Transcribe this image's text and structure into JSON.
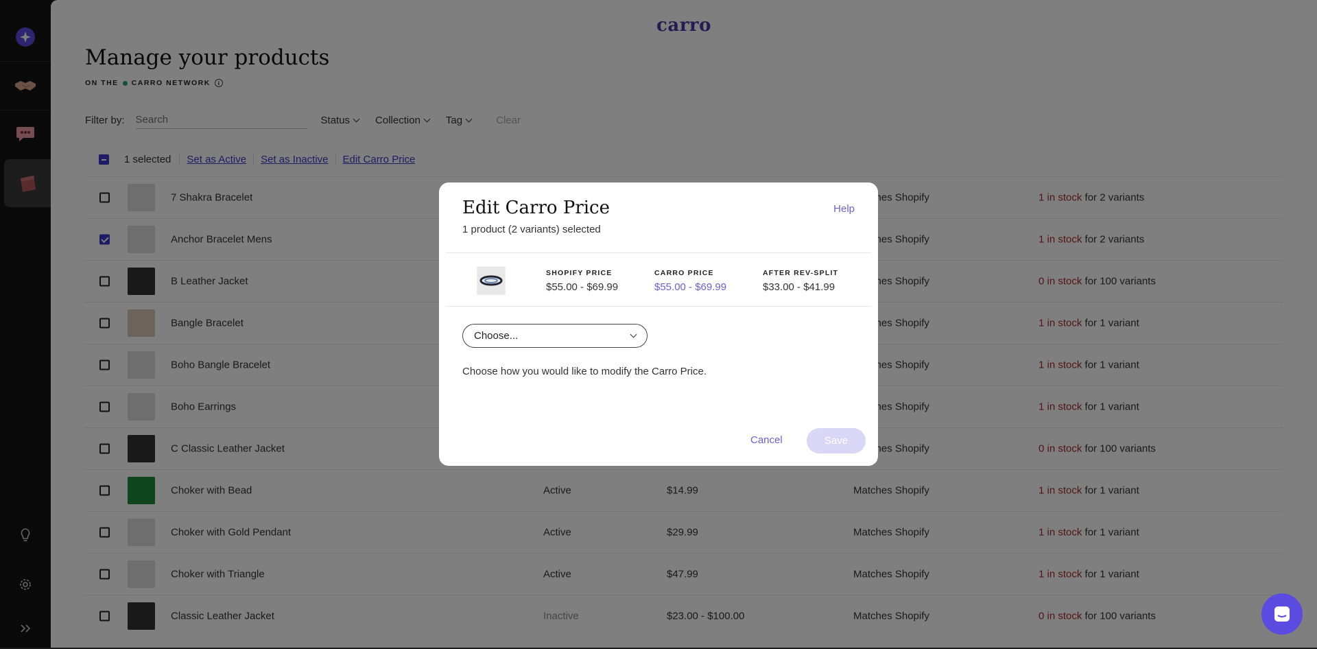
{
  "app": {
    "logo": "carro"
  },
  "page": {
    "title": "Manage your products",
    "subtitle_prefix": "ON THE",
    "subtitle_network": "CARRO NETWORK"
  },
  "filters": {
    "label": "Filter by:",
    "search_placeholder": "Search",
    "status": "Status",
    "collection": "Collection",
    "tag": "Tag",
    "clear": "Clear"
  },
  "bulk": {
    "selected": "1 selected",
    "set_active": "Set as Active",
    "set_inactive": "Set as Inactive",
    "edit_price": "Edit Carro Price"
  },
  "rows": [
    {
      "name": "7 Shakra Bracelet",
      "status": "",
      "price": "",
      "match": "Matches Shopify",
      "stock": "1 in stock",
      "variants": " for 2 variants",
      "checked": false
    },
    {
      "name": "Anchor Bracelet Mens",
      "status": "",
      "price": "",
      "match": "Matches Shopify",
      "stock": "1 in stock",
      "variants": " for 2 variants",
      "checked": true
    },
    {
      "name": "B Leather Jacket",
      "status": "",
      "price": "",
      "match": "Matches Shopify",
      "stock": "0 in stock",
      "variants": " for 100 variants",
      "checked": false
    },
    {
      "name": "Bangle Bracelet",
      "status": "",
      "price": "",
      "match": "Matches Shopify",
      "stock": "1 in stock",
      "variants": " for 1 variant",
      "checked": false
    },
    {
      "name": "Boho Bangle Bracelet",
      "status": "",
      "price": "",
      "match": "Matches Shopify",
      "stock": "1 in stock",
      "variants": " for 1 variant",
      "checked": false
    },
    {
      "name": "Boho Earrings",
      "status": "",
      "price": "",
      "match": "Matches Shopify",
      "stock": "1 in stock",
      "variants": " for 1 variant",
      "checked": false
    },
    {
      "name": "C Classic Leather Jacket",
      "status": "",
      "price": "",
      "match": "Matches Shopify",
      "stock": "0 in stock",
      "variants": " for 100 variants",
      "checked": false
    },
    {
      "name": "Choker with Bead",
      "status": "Active",
      "price": "$14.99",
      "match": "Matches Shopify",
      "stock": "1 in stock",
      "variants": " for 1 variant",
      "checked": false
    },
    {
      "name": "Choker with Gold Pendant",
      "status": "Active",
      "price": "$29.99",
      "match": "Matches Shopify",
      "stock": "1 in stock",
      "variants": " for 1 variant",
      "checked": false
    },
    {
      "name": "Choker with Triangle",
      "status": "Active",
      "price": "$47.99",
      "match": "Matches Shopify",
      "stock": "1 in stock",
      "variants": " for 1 variant",
      "checked": false
    },
    {
      "name": "Classic Leather Jacket",
      "status": "Inactive",
      "price": "$23.00 - $100.00",
      "match": "Matches Shopify",
      "stock": "0 in stock",
      "variants": " for 100 variants",
      "checked": false
    }
  ],
  "modal": {
    "title": "Edit Carro Price",
    "subtitle": "1 product (2 variants) selected",
    "help": "Help",
    "shopify_label": "SHOPIFY PRICE",
    "shopify_value": "$55.00 - $69.99",
    "carro_label": "CARRO PRICE",
    "carro_value": "$55.00 - $69.99",
    "rev_label": "AFTER REV-SPLIT",
    "rev_value": "$33.00 - $41.99",
    "select_value": "Choose...",
    "description": "Choose how you would like to modify the Carro Price.",
    "cancel": "Cancel",
    "save": "Save"
  },
  "colors": {
    "accent": "#3f37c9",
    "link": "#6b62d6",
    "stock_red": "#a52a2a",
    "save_disabled": "#d9d6f6"
  }
}
